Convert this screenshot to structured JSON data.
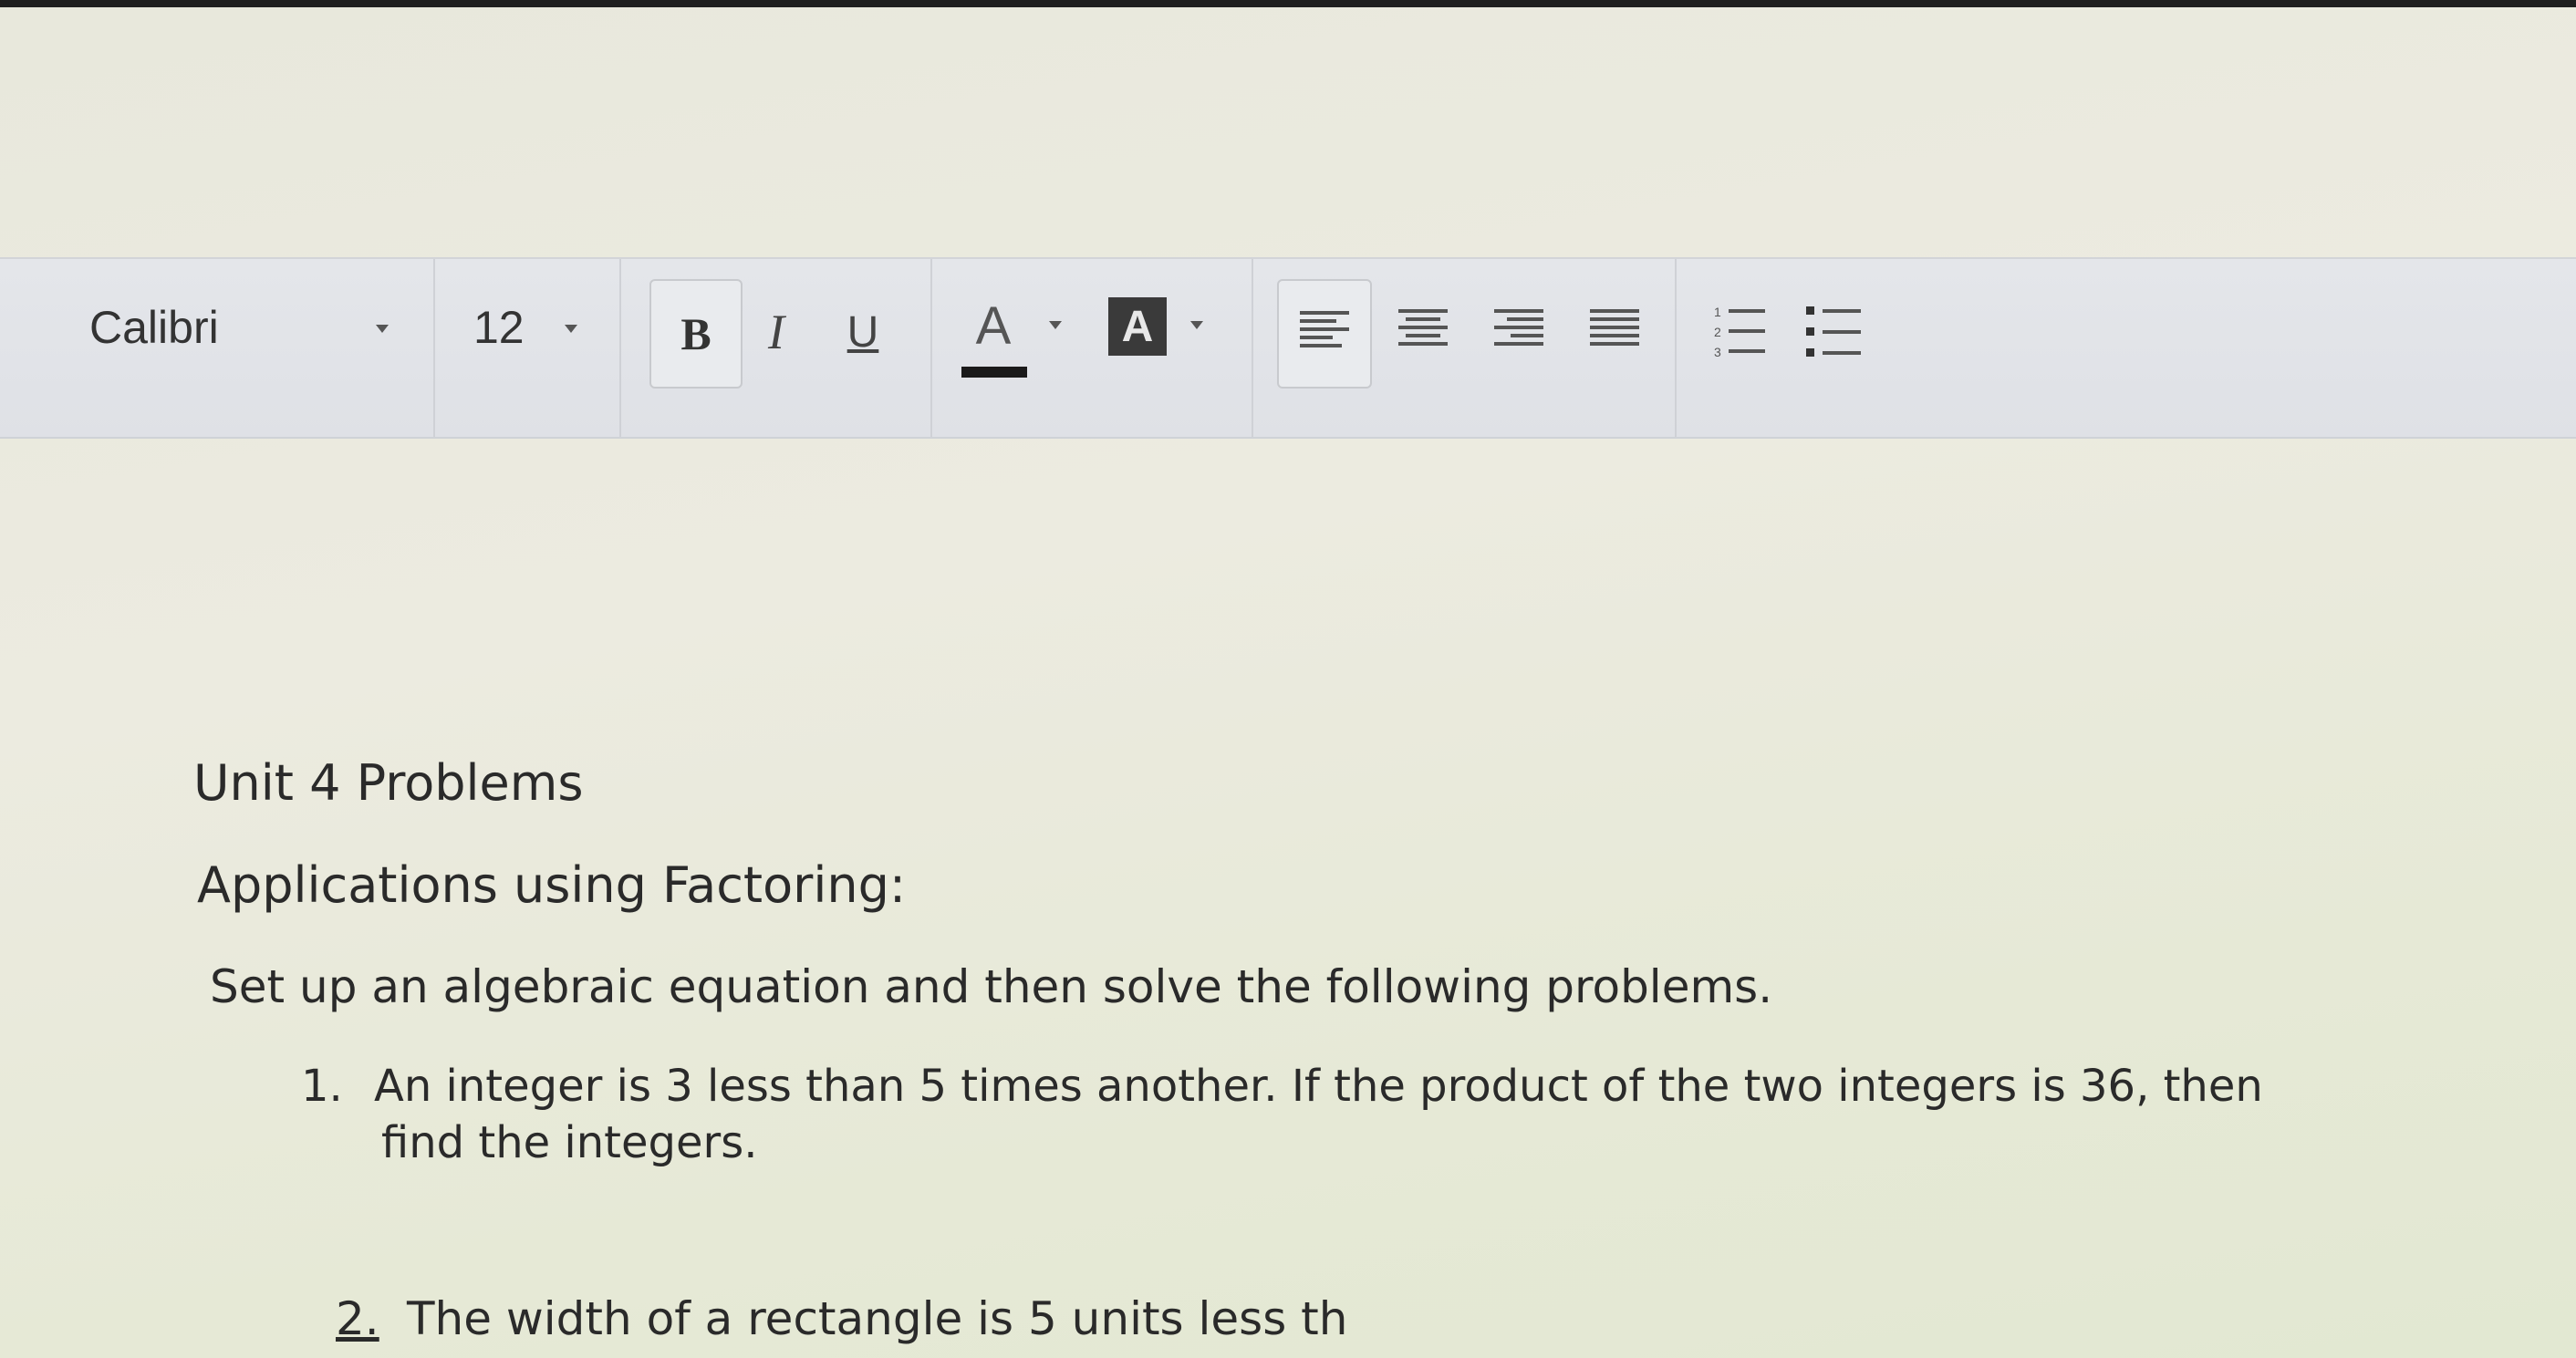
{
  "toolbar": {
    "font_family": "Calibri",
    "font_size": "12",
    "bold_label": "B",
    "italic_label": "I",
    "underline_label": "U",
    "font_color_label": "A",
    "highlight_label": "A",
    "icons": [
      "chevron-down-icon",
      "align-left-icon",
      "align-center-icon",
      "align-right-icon",
      "align-justify-icon",
      "numbered-list-icon",
      "bulleted-list-icon"
    ],
    "colors": {
      "font_color_bar": "#1a1a1a",
      "highlight_bg": "#3a3a3a"
    }
  },
  "document": {
    "title": "Unit 4 Problems",
    "subtitle": "Applications using Factoring:",
    "instructions": "Set up an algebraic equation and then solve the following problems.",
    "problems": [
      {
        "number": "1.",
        "line1": "An integer is 3 less than 5 times another. If the product of the two integers is 36, then",
        "line2": "find the integers."
      },
      {
        "number": "2.",
        "line1": "The width of a rectangle is 5 units less th"
      }
    ]
  }
}
